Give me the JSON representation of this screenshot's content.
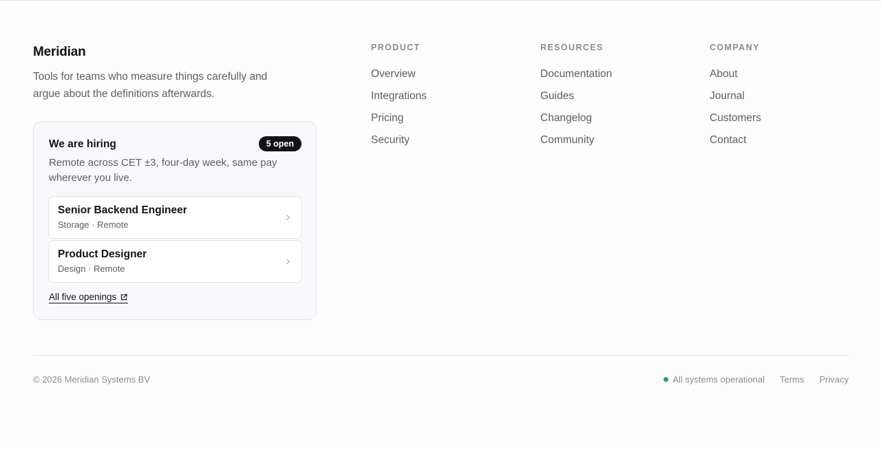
{
  "brand": {
    "name": "Meridian",
    "tagline": "Tools for teams who measure things carefully and argue about the definitions afterwards."
  },
  "hiring": {
    "title": "We are hiring",
    "badge": "5 open",
    "description": "Remote across CET ±3, four-day week, same pay wherever you live.",
    "jobs": [
      {
        "title": "Senior Backend Engineer",
        "meta": "Storage · Remote"
      },
      {
        "title": "Product Designer",
        "meta": "Design · Remote"
      }
    ],
    "all_link": "All five openings"
  },
  "columns": {
    "product": {
      "heading": "PRODUCT",
      "links": [
        "Overview",
        "Integrations",
        "Pricing",
        "Security"
      ]
    },
    "resources": {
      "heading": "RESOURCES",
      "links": [
        "Documentation",
        "Guides",
        "Changelog",
        "Community"
      ]
    },
    "company": {
      "heading": "COMPANY",
      "links": [
        "About",
        "Journal",
        "Customers",
        "Contact"
      ]
    }
  },
  "bottom": {
    "copyright": "© 2026 Meridian Systems BV",
    "status": "All systems operational",
    "status_color": "#22a55b",
    "terms": "Terms",
    "privacy": "Privacy"
  }
}
